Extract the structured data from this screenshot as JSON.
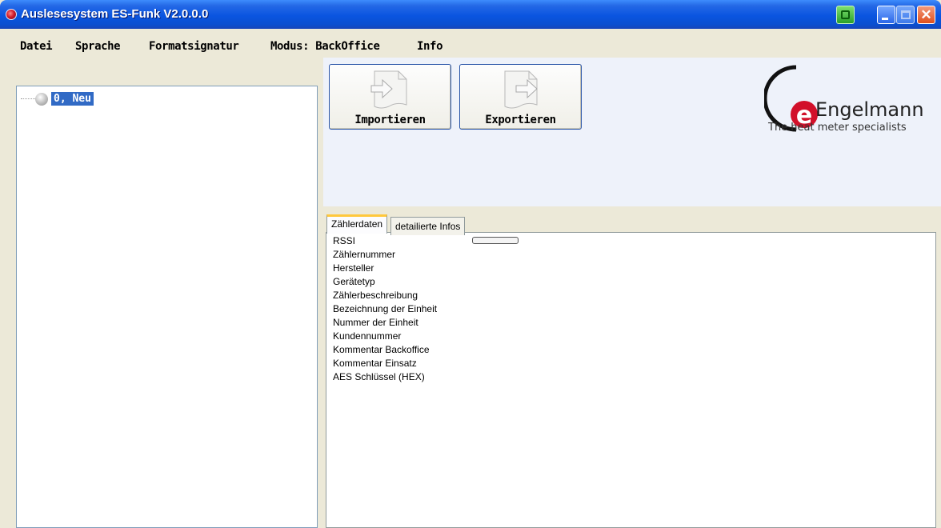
{
  "window": {
    "title": "Auslesesystem ES-Funk V2.0.0.0"
  },
  "menu": [
    "Datei",
    "Sprache",
    "Formatsignatur",
    "Modus: BackOffice",
    "Info"
  ],
  "tree": {
    "node_label": "0, Neu"
  },
  "toolbar": {
    "import_label": "Importieren",
    "export_label": "Exportieren"
  },
  "logo": {
    "name": "Engelmann",
    "tagline": "The heat meter specialists",
    "brand_color": "#d2102a"
  },
  "tabs": [
    {
      "label": "Zählerdaten",
      "active": true
    },
    {
      "label": "detailierte Infos",
      "active": false
    }
  ],
  "fields": [
    "RSSI",
    "Zählernummer",
    "Hersteller",
    "Gerätetyp",
    "Zählerbeschreibung",
    "Bezeichnung der Einheit",
    "Nummer der Einheit",
    "Kundennummer",
    "Kommentar Backoffice",
    "Kommentar Einsatz",
    "AES Schlüssel (HEX)"
  ],
  "rssi": {
    "level": 0
  }
}
